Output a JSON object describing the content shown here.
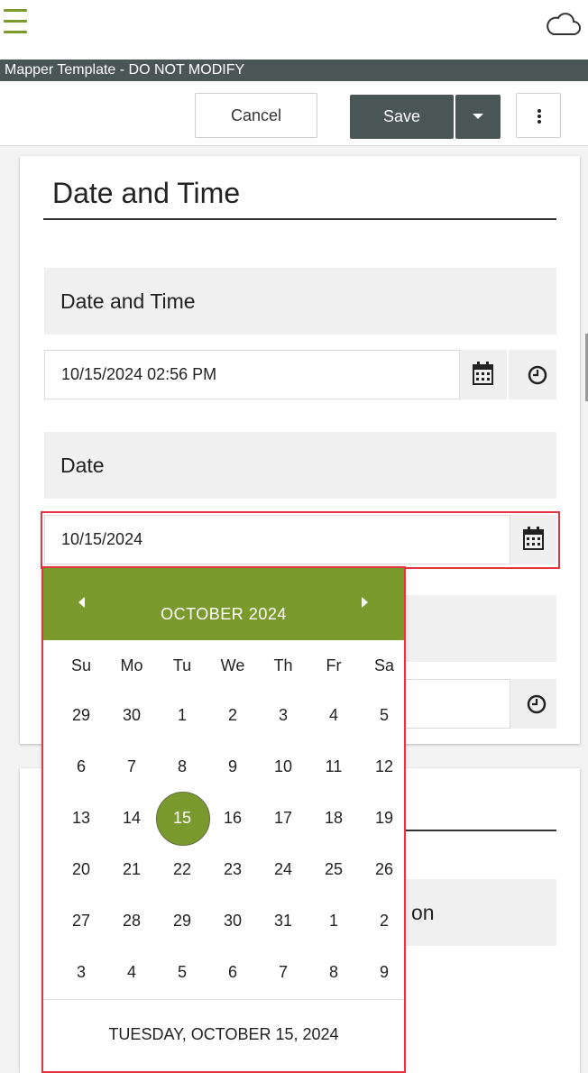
{
  "header": {
    "menu_icon": "hamburger-menu-icon",
    "cloud_icon": "cloud-icon"
  },
  "form_title": "Mapper Template - DO NOT MODIFY",
  "toolbar": {
    "cancel_label": "Cancel",
    "save_label": "Save",
    "save_dropdown_icon": "caret-down-icon",
    "more_icon": "vertical-ellipsis-icon"
  },
  "section": {
    "title": "Date and Time",
    "fields": [
      {
        "label": "Date and Time",
        "value": "10/15/2024 02:56 PM"
      },
      {
        "label": "Date",
        "value": "10/15/2024"
      }
    ]
  },
  "second_section_partial_label": "on",
  "datepicker": {
    "month_label": "OCTOBER 2024",
    "weekdays": [
      "Su",
      "Mo",
      "Tu",
      "We",
      "Th",
      "Fr",
      "Sa"
    ],
    "weeks": [
      [
        "29",
        "30",
        "1",
        "2",
        "3",
        "4",
        "5"
      ],
      [
        "6",
        "7",
        "8",
        "9",
        "10",
        "11",
        "12"
      ],
      [
        "13",
        "14",
        "15",
        "16",
        "17",
        "18",
        "19"
      ],
      [
        "20",
        "21",
        "22",
        "23",
        "24",
        "25",
        "26"
      ],
      [
        "27",
        "28",
        "29",
        "30",
        "31",
        "1",
        "2"
      ],
      [
        "3",
        "4",
        "5",
        "6",
        "7",
        "8",
        "9"
      ]
    ],
    "selected_day": "15",
    "footer_label": "TUESDAY, OCTOBER 15, 2024"
  },
  "colors": {
    "accent_green": "#7b9a2e",
    "dark_slate": "#4a5556",
    "highlight_red": "#e5333f"
  }
}
